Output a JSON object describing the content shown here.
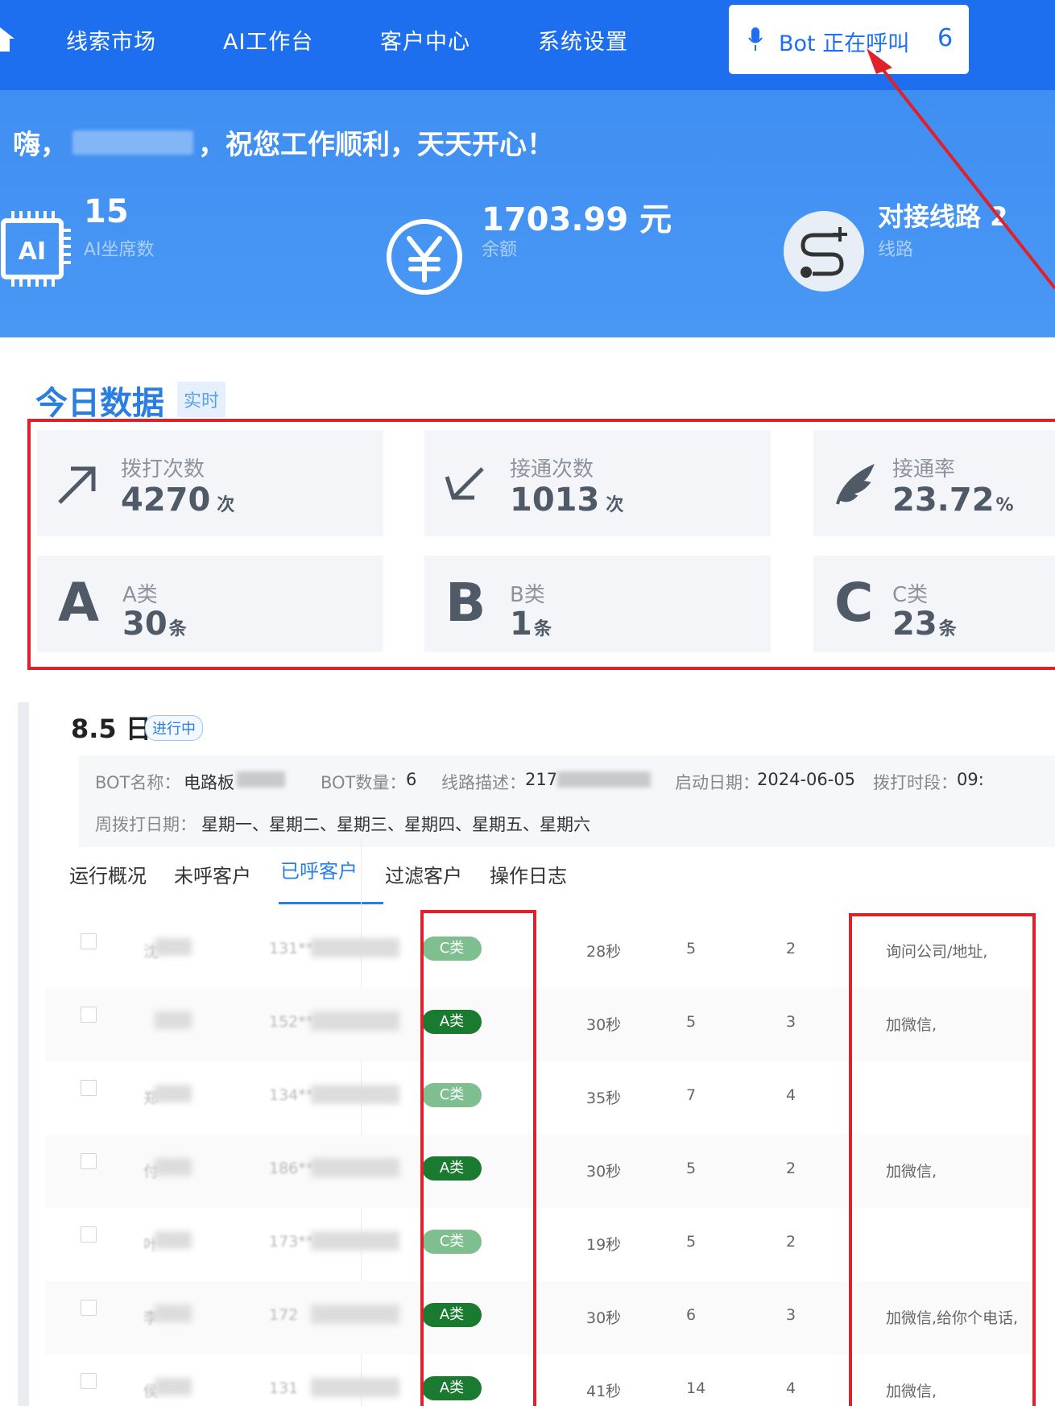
{
  "nav": {
    "home_icon": "home-icon",
    "items": [
      "线索市场",
      "AI工作台",
      "客户中心",
      "系统设置"
    ],
    "bot_status": {
      "label": "Bot 正在呼叫",
      "count": "6",
      "icon": "microphone-icon"
    }
  },
  "hero": {
    "greeting_prefix": "嗨，",
    "greeting_suffix": "，祝您工作顺利，天天开心！",
    "stats": [
      {
        "value": "15",
        "label": "AI坐席数",
        "icon": "ai-chip-icon"
      },
      {
        "value": "1703.99 元",
        "label": "余额",
        "icon": "yen-icon"
      },
      {
        "value": "对接线路 2",
        "label": "线路",
        "icon": "route-icon"
      }
    ]
  },
  "today": {
    "title": "今日数据",
    "badge": "实时",
    "cards": [
      {
        "label": "拨打次数",
        "value": "4270",
        "unit": "次",
        "icon": "arrow-up-right-icon"
      },
      {
        "label": "接通次数",
        "value": "1013",
        "unit": "次",
        "icon": "arrow-down-left-icon"
      },
      {
        "label": "接通率",
        "value": "23.72",
        "unit": "%",
        "icon": "feather-icon"
      },
      {
        "label": "A类",
        "value": "30",
        "unit": "条",
        "letter": "A"
      },
      {
        "label": "B类",
        "value": "1",
        "unit": "条",
        "letter": "B"
      },
      {
        "label": "C类",
        "value": "23",
        "unit": "条",
        "letter": "C"
      }
    ]
  },
  "detail": {
    "date": "8.5 日",
    "status": "进行中",
    "info": {
      "bot_name_key": "BOT名称：",
      "bot_name_val": "电路板",
      "bot_count_key": "BOT数量：",
      "bot_count_val": "6",
      "line_desc_key": "线路描述：",
      "line_desc_val": "217",
      "start_date_key": "启动日期：",
      "start_date_val": "2024-06-05",
      "dial_period_key": "拨打时段：",
      "dial_period_val": "09:",
      "weekdays_key": "周拨打日期：",
      "weekdays_val": "星期一、星期二、星期三、星期四、星期五、星期六"
    },
    "tabs": [
      "运行概况",
      "未呼客户",
      "已呼客户",
      "过滤客户",
      "操作日志"
    ],
    "active_tab": "已呼客户",
    "rows": [
      {
        "name": "沈",
        "phone": "131***",
        "tag": "C类",
        "duration": "28秒",
        "rounds": "5",
        "count": "2",
        "note": "询问公司/地址,"
      },
      {
        "name": "",
        "phone": "152**",
        "tag": "A类",
        "duration": "30秒",
        "rounds": "5",
        "count": "3",
        "note": "加微信,"
      },
      {
        "name": "郑",
        "phone": "134**",
        "tag": "C类",
        "duration": "35秒",
        "rounds": "7",
        "count": "4",
        "note": ""
      },
      {
        "name": "付",
        "phone": "186***",
        "tag": "A类",
        "duration": "30秒",
        "rounds": "5",
        "count": "2",
        "note": "加微信,"
      },
      {
        "name": "叶",
        "phone": "173**",
        "tag": "C类",
        "duration": "19秒",
        "rounds": "5",
        "count": "2",
        "note": ""
      },
      {
        "name": "李",
        "phone": "172",
        "tag": "A类",
        "duration": "30秒",
        "rounds": "6",
        "count": "3",
        "note": "加微信,给你个电话,"
      },
      {
        "name": "侯",
        "phone": "131",
        "tag": "A类",
        "duration": "41秒",
        "rounds": "14",
        "count": "4",
        "note": "加微信,"
      }
    ]
  },
  "colors": {
    "nav_bg": "#1d6ff0",
    "hero_bg": "#4593f3",
    "accent": "#2a7ee0",
    "annotation_red": "#e0202a",
    "tag_a": "#1a7a30",
    "tag_c": "#7fbf8f"
  }
}
